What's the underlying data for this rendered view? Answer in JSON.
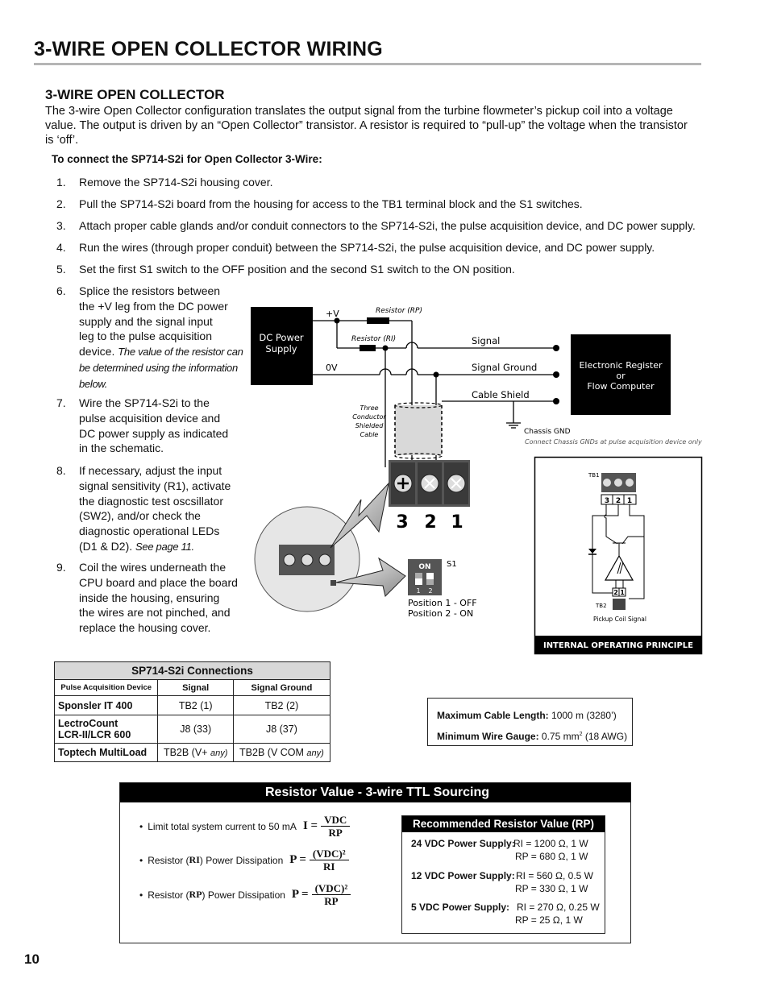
{
  "page": {
    "title": "3-WIRE OPEN COLLECTOR WIRING",
    "page_number": "10"
  },
  "section": {
    "heading": "3-WIRE OPEN COLLECTOR",
    "intro": "The 3-wire Open Collector configuration translates the output signal from the turbine flowmeter’s pickup coil into a voltage value. The output is driven by an “Open Collector” transistor.  A resistor is required to “pull-up” the voltage when the transistor is ‘off’.",
    "steps_heading": "To connect the SP714-S2i for Open Collector 3-Wire:"
  },
  "steps": [
    {
      "num": "1.",
      "text": "Remove the SP714-S2i housing cover."
    },
    {
      "num": "2.",
      "text": "Pull the SP714-S2i board from the housing for access to the TB1 terminal block and the S1 switches."
    },
    {
      "num": "3.",
      "text": "Attach proper cable glands and/or conduit connectors to the SP714-S2i, the pulse acquisition device, and DC power supply."
    },
    {
      "num": "4.",
      "text": "Run the wires (through proper conduit) between the SP714-S2i, the pulse acquisition device, and DC power supply."
    },
    {
      "num": "5.",
      "text": "Set the first S1 switch to the OFF position and the second S1 switch to the ON position."
    },
    {
      "num": "6.",
      "lines": [
        "Splice the resistors between",
        "the +V leg from the DC power",
        "supply and the signal input",
        "leg to the pulse acquisition",
        "device."
      ],
      "note_lines": [
        "The value of the resistor can",
        "be determined using the information",
        "below."
      ]
    },
    {
      "num": "7.",
      "lines": [
        "Wire the SP714-S2i to the",
        "pulse acquisition device and",
        "DC power supply as indicated",
        "in the schematic."
      ]
    },
    {
      "num": "8.",
      "lines": [
        "If necessary, adjust the input",
        "signal sensitivity (R1), activate",
        "the diagnostic test oscsillator",
        "(SW2), and/or check the",
        "diagnostic operational LEDs",
        "(D1 & D2)."
      ],
      "note": "See page 11."
    },
    {
      "num": "9.",
      "lines": [
        "Coil the wires underneath the",
        "CPU board and place the board",
        "inside the housing, ensuring",
        "the wires are not pinched, and",
        "replace the housing cover."
      ]
    }
  ],
  "diagram": {
    "dc_supply_lines": [
      "DC Power",
      "Supply"
    ],
    "plus_v": "+V",
    "zero_v": "0V",
    "resistor_rp": "Resistor (RP)",
    "resistor_ri": "Resistor (RI)",
    "signal": "Signal",
    "signal_ground": "Signal Ground",
    "cable_shield": "Cable Shield",
    "register_lines": [
      "Electronic Register",
      "or",
      "Flow Computer"
    ],
    "cable_lines": [
      "Three",
      "Conductor",
      "Shielded",
      "Cable"
    ],
    "chassis_gnd": "Chassis GND",
    "chassis_note": "Connect Chassis GNDs at pulse acquisition device only",
    "terminal_numbers": [
      "3",
      "2",
      "1"
    ],
    "switch_on": "ON",
    "switch_name": "S1",
    "switch_positions": [
      "1",
      "2"
    ],
    "position_1": "Position 1 - OFF",
    "position_2": "Position 2 - ON",
    "internal": {
      "tb1": "TB1",
      "tb1_pins": [
        "3",
        "2",
        "1"
      ],
      "tb2": "TB2",
      "tb2_pins": [
        "2",
        "1"
      ],
      "pickup": "Pickup Coil Signal",
      "caption": "INTERNAL OPERATING PRINCIPLE"
    }
  },
  "connections_table": {
    "caption": "SP714-S2i Connections",
    "headers": [
      "Pulse Acquisition Device",
      "Signal",
      "Signal Ground"
    ],
    "rows": [
      {
        "device": "Sponsler IT 400",
        "signal": "TB2 (1)",
        "ground": "TB2 (2)"
      },
      {
        "device_lines": [
          "LectroCount",
          "LCR-II/LCR 600"
        ],
        "signal": "J8 (33)",
        "ground": "J8 (37)"
      },
      {
        "device": "Toptech MultiLoad",
        "signal_main": "TB2B (V+ ",
        "signal_em": "any)",
        "ground_main": "TB2B (V COM ",
        "ground_em": "any)"
      }
    ]
  },
  "specs": {
    "max_cable_label": "Maximum Cable Length:",
    "max_cable_value": "1000 m (3280’)",
    "min_gauge_label": "Minimum Wire Gauge:",
    "min_gauge_value_pre": "0.75 mm",
    "min_gauge_sup": "2",
    "min_gauge_value_post": " (18 AWG)"
  },
  "resistor_panel": {
    "title": "Resistor Value - 3-wire TTL Sourcing",
    "formulas": [
      {
        "bullet": "•",
        "text": "Limit total system current to 50 mA",
        "var": "I =",
        "num": "VDC",
        "den": "RP"
      },
      {
        "bullet": "•",
        "text_pre": "Resistor (",
        "sym": "RI",
        "text_post": ") Power Dissipation",
        "var": "P =",
        "num": "(VDC)²",
        "den": "RI"
      },
      {
        "bullet": "•",
        "text_pre": "Resistor (",
        "sym": "RP",
        "text_post": ") Power Dissipation",
        "var": "P =",
        "num": "(VDC)²",
        "den": "RP"
      }
    ],
    "recommended": {
      "title": "Recommended Resistor Value (RP)",
      "rows": [
        {
          "label": "24 VDC Power Supply:",
          "ri": "RI = 1200 Ω, 1 W",
          "rp": "RP = 680 Ω, 1 W"
        },
        {
          "label": "12 VDC Power Supply:",
          "ri": "RI = 560 Ω, 0.5 W",
          "rp": "RP = 330 Ω, 1 W"
        },
        {
          "label": "5 VDC Power Supply:",
          "ri": "RI = 270 Ω, 0.25 W",
          "rp": "RP = 25 Ω, 1 W"
        }
      ]
    }
  },
  "colors": {
    "title_rule": "#b5b5b5",
    "block_black": "#000000",
    "cable_gray": "#d9d9d9",
    "terminal_dark": "#3a3a3a",
    "table_caption_bg": "#d8d8d8"
  }
}
